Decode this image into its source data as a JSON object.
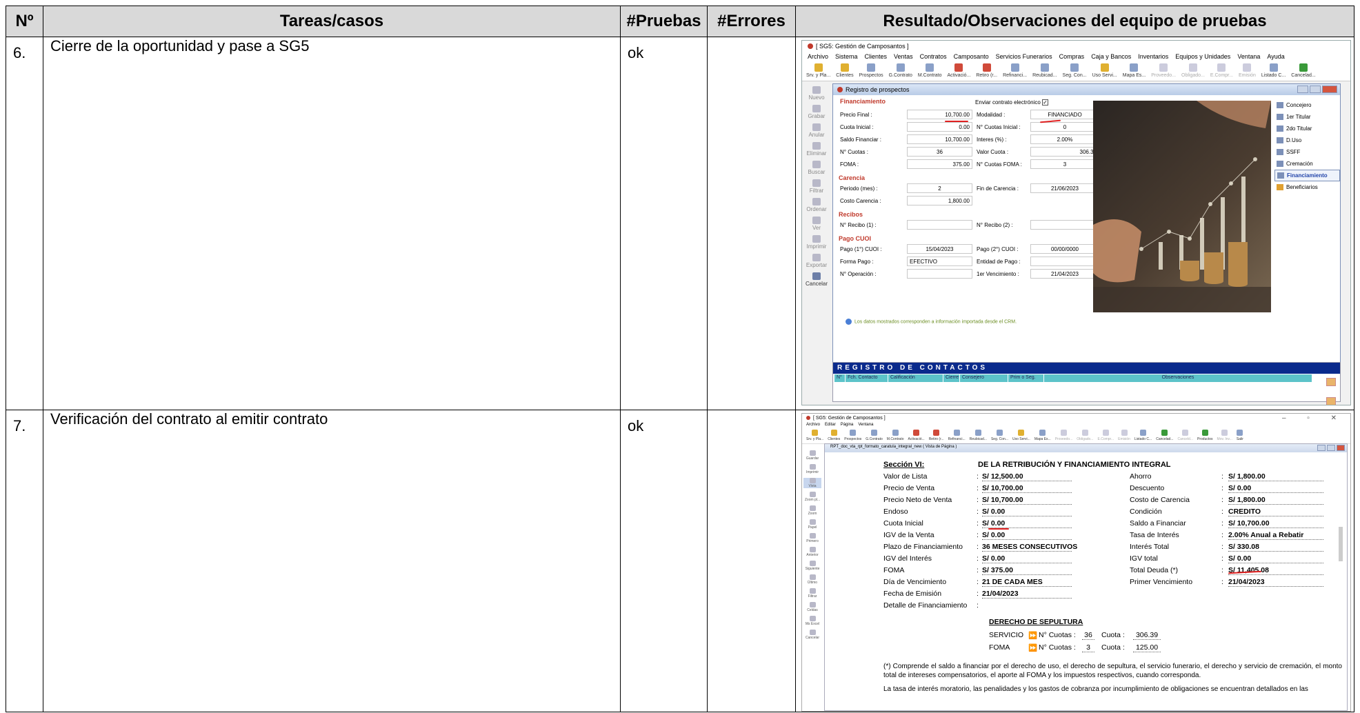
{
  "table": {
    "headers": {
      "num": "Nº",
      "tasks": "Tareas/casos",
      "tests": "#Pruebas",
      "errors": "#Errores",
      "results": "Resultado/Observaciones del equipo de pruebas"
    },
    "rows": [
      {
        "num": "6.",
        "task": "Cierre de la oportunidad y pase a SG5",
        "tests": "ok",
        "errors": ""
      },
      {
        "num": "7.",
        "task": "Verificación del contrato al emitir contrato",
        "tests": "ok",
        "errors": ""
      }
    ]
  },
  "shot1": {
    "app_title": "[ SG5: Gestión de Camposantos ]",
    "menu": [
      "Archivo",
      "Sistema",
      "Clientes",
      "Ventas",
      "Contratos",
      "Camposanto",
      "Servicios Funerarios",
      "Compras",
      "Caja y Bancos",
      "Inventarios",
      "Equipos y Unidades",
      "Ventana",
      "Ayuda"
    ],
    "toolbar": [
      "Srv. y Pla...",
      "Clientes",
      "Prospectos",
      "G.Contrato",
      "M.Contrato",
      "Activació...",
      "Retiro (r...",
      "Refinanci...",
      "Reubicad...",
      "Seg. Con...",
      "Uso Servi...",
      "Mapa Es...",
      "Proveedo...",
      "Obligado...",
      "E.Compr...",
      "Emisión",
      "Listado C...",
      "Cancelad..."
    ],
    "side": [
      "Nuevo",
      "Grabar",
      "Anular",
      "Eliminar",
      "Buscar",
      "Filtrar",
      "Ordenar",
      "Ver",
      "Imprimir",
      "Exportar",
      "Cancelar"
    ],
    "window_title": "Registro de prospectos",
    "send_contract": "Enviar contrato electrónico",
    "sections": {
      "financiamiento": "Financiamiento",
      "carencia": "Carencia",
      "recibos": "Recibos",
      "pago": "Pago CUOI"
    },
    "fields": {
      "precio_final": {
        "label": "Precio Final :",
        "value": "10,700.00"
      },
      "modalidad": {
        "label": "Modalidad :",
        "value": "FINANCIADO"
      },
      "cuota_inicial": {
        "label": "Cuota Inicial :",
        "value": "0.00"
      },
      "n_cuotas_inicial": {
        "label": "N° Cuotas Inicial :",
        "value": "0"
      },
      "saldo_financiar": {
        "label": "Saldo Financiar :",
        "value": "10,700.00"
      },
      "interes": {
        "label": "Interes (%) :",
        "value": "2.00%"
      },
      "n_cuotas": {
        "label": "N° Cuotas :",
        "value": "36"
      },
      "valor_cuota": {
        "label": "Valor Cuota :",
        "value": "306.39"
      },
      "foma": {
        "label": "FOMA :",
        "value": "375.00"
      },
      "n_cuotas_foma": {
        "label": "N° Cuotas FOMA :",
        "value": "3"
      },
      "periodo": {
        "label": "Periodo (mes) :",
        "value": "2"
      },
      "fin_carencia": {
        "label": "Fin de Carencia :",
        "value": "21/06/2023"
      },
      "costo_carencia": {
        "label": "Costo Carencia :",
        "value": "1,800.00"
      },
      "recibo1": {
        "label": "N° Recibo (1) :",
        "value": ""
      },
      "recibo2": {
        "label": "N° Recibo (2) :",
        "value": ""
      },
      "pago1": {
        "label": "Pago (1°) CUOI :",
        "value": "15/04/2023"
      },
      "pago2": {
        "label": "Pago (2°) CUOI :",
        "value": "00/00/0000"
      },
      "forma_pago": {
        "label": "Forma Pago :",
        "value": "EFECTIVO"
      },
      "entidad_pago": {
        "label": "Entidad de Pago :",
        "value": ""
      },
      "n_operacion": {
        "label": "N° Operación :",
        "value": ""
      },
      "primer_venc": {
        "label": "1er Vencimiento :",
        "value": "21/04/2023"
      }
    },
    "info": "Los datos mostrados corresponden a información importada desde el CRM.",
    "tabs": [
      "Concejero",
      "1er Titular",
      "2do Titular",
      "D.Uso",
      "SSFF",
      "Cremación",
      "Financiamiento",
      "Beneficiarios"
    ],
    "contacts_title": "REGISTRO DE CONTACTOS",
    "contacts_cols": [
      "N°",
      "Fch. Contacto",
      "Calificación",
      "Cierre",
      "Consejero",
      "Prim o Seg.",
      "Observaciones"
    ],
    "colors": {
      "accent_red": "#c0392b",
      "band_blue": "#0a2a8c",
      "grid_head": "#5cc3c9"
    }
  },
  "shot2": {
    "app_title": "[ SG5: Gestión de Camposantos ]",
    "menu": [
      "Archivo",
      "Editar",
      "Página",
      "Ventana"
    ],
    "toolbar": [
      "Srv. y Pla...",
      "Clientes",
      "Prospectos",
      "G.Contrato",
      "M.Contrato",
      "Activació...",
      "Retiro (r...",
      "Refinanci...",
      "Reubicad...",
      "Seg. Con...",
      "Uso Servi...",
      "Mapa Es...",
      "Proveedo...",
      "Obligado...",
      "E.Compr...",
      "Emisión",
      "Listado C...",
      "Cancelad...",
      "Canceld...",
      "Productos",
      "Mov. Inv...",
      "Salir"
    ],
    "side": [
      "Guardar",
      "Imprimir",
      "Vista",
      "Zoom pl...",
      "Zoom",
      "Papel",
      "Primero",
      "Anterior",
      "Siguiente",
      "Último",
      "Filtrar",
      "Celdas",
      "Ms Excel",
      "Cancelar"
    ],
    "window_title": "RPT_doc_vta_rpt_formato_caratula_integral_new ( Vista de Página )",
    "section_label": "Sección VI:",
    "section_title": "DE LA RETRIBUCIÓN Y FINANCIAMIENTO INTEGRAL",
    "left": [
      {
        "k": "Valor de Lista",
        "v": "S/ 12,500.00"
      },
      {
        "k": "Precio de Venta",
        "v": "S/ 10,700.00"
      },
      {
        "k": "Precio Neto de Venta",
        "v": "S/ 10,700.00"
      },
      {
        "k": "Endoso",
        "v": "S/ 0.00"
      },
      {
        "k": "Cuota Inicial",
        "v": "S/ 0.00"
      },
      {
        "k": "IGV de la Venta",
        "v": "S/ 0.00"
      },
      {
        "k": "Plazo de Financiamiento",
        "v": "36 MESES CONSECUTIVOS"
      },
      {
        "k": "IGV del Interés",
        "v": "S/ 0.00"
      },
      {
        "k": "FOMA",
        "v": "S/ 375.00"
      },
      {
        "k": "Día de Vencimiento",
        "v": "21 DE CADA MES"
      },
      {
        "k": "Fecha de Emisión",
        "v": "21/04/2023"
      },
      {
        "k": "Detalle de Financiamiento",
        "v": ""
      }
    ],
    "right": [
      {
        "k": "Ahorro",
        "v": "S/ 1,800.00"
      },
      {
        "k": "Descuento",
        "v": "S/ 0.00"
      },
      {
        "k": "Costo de Carencia",
        "v": "S/ 1,800.00"
      },
      {
        "k": "Condición",
        "v": "CREDITO"
      },
      {
        "k": "Saldo a Financiar",
        "v": "S/ 10,700.00"
      },
      {
        "k": "Tasa de Interés",
        "v": "2.00% Anual a Rebatir"
      },
      {
        "k": "Interés Total",
        "v": "S/ 330.08"
      },
      {
        "k": "IGV total",
        "v": "S/ 0.00"
      },
      {
        "k": "Total Deuda (*)",
        "v": "S/ 11,405.08"
      },
      {
        "k": "Primer Vencimiento",
        "v": "21/04/2023"
      }
    ],
    "derecho": "DERECHO DE SEPULTURA",
    "servicio": {
      "name": "SERVICIO",
      "ncuotas_label": "N° Cuotas :",
      "ncuotas": "36",
      "cuota_label": "Cuota :",
      "cuota": "306.39"
    },
    "foma_row": {
      "name": "FOMA",
      "ncuotas_label": "N° Cuotas :",
      "ncuotas": "3",
      "cuota_label": "Cuota :",
      "cuota": "125.00"
    },
    "footnote": "(*) Comprende el saldo a financiar por el derecho de uso, el derecho de sepultura, el servicio funerario, el derecho y servicio de cremación, el monto total de intereses compensatorios, el aporte al FOMA y los impuestos respectivos, cuando corresponda.",
    "footnote2": "La tasa de interés moratorio, las penalidades y los gastos de cobranza por incumplimiento de obligaciones se encuentran detallados en las"
  }
}
